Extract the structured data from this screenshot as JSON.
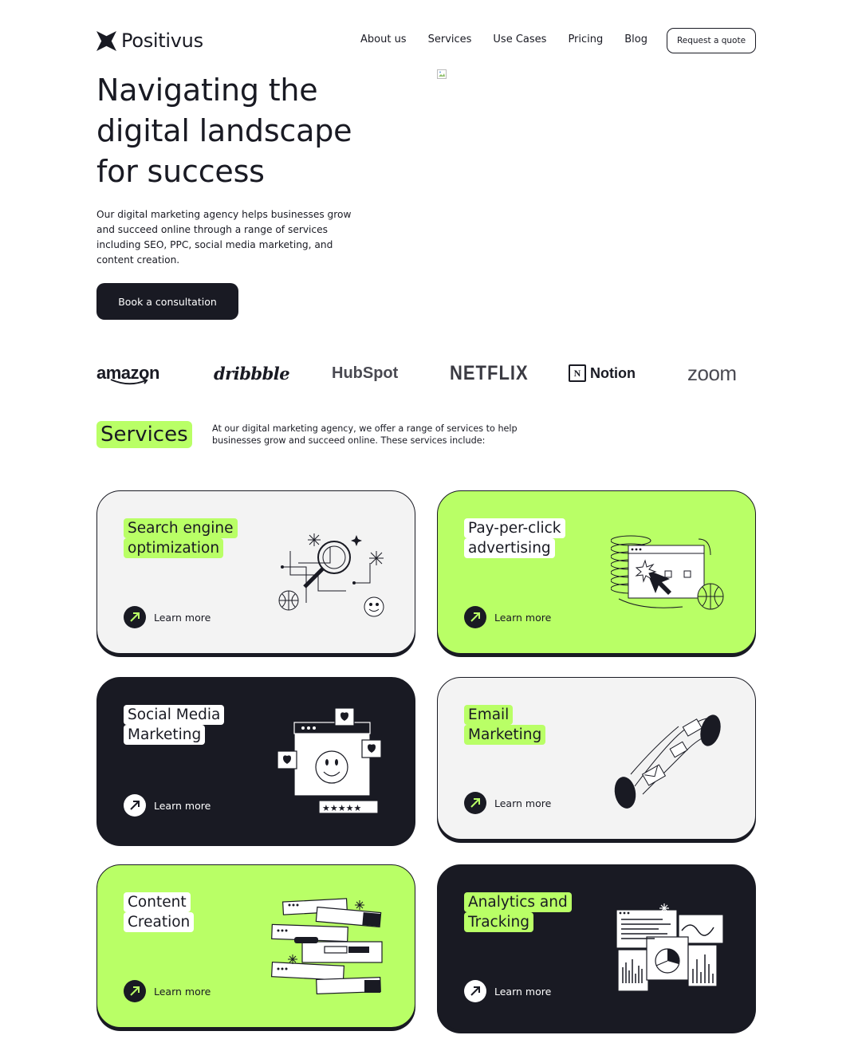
{
  "header": {
    "brand": "Positivus",
    "nav": [
      "About us",
      "Services",
      "Use Cases",
      "Pricing",
      "Blog"
    ],
    "cta": "Request a quote"
  },
  "hero": {
    "title": "Navigating the digital landscape for success",
    "description": "Our digital marketing agency helps businesses grow and succeed online through a range of services including SEO, PPC, social media marketing, and content creation.",
    "button": "Book a consultation"
  },
  "clients": {
    "amazon": "amazon",
    "dribbble": "dribbble",
    "hubspot": "HubSpot",
    "netflix": "NETFLIX",
    "notion": "Notion",
    "zoom": "zoom"
  },
  "services": {
    "title": "Services",
    "description": "At our digital marketing agency, we offer a range of services to help businesses grow and succeed online. These services include:",
    "learn_more": "Learn more",
    "cards": [
      {
        "line1": "Search engine",
        "line2": "optimization"
      },
      {
        "line1": "Pay-per-click",
        "line2": "advertising"
      },
      {
        "line1": "Social Media",
        "line2": "Marketing"
      },
      {
        "line1": "Email",
        "line2": "Marketing"
      },
      {
        "line1": "Content",
        "line2": "Creation"
      },
      {
        "line1": "Analytics and",
        "line2": "Tracking"
      }
    ]
  },
  "colors": {
    "accent": "#B9FF66",
    "dark": "#191A23",
    "grey": "#F3F3F3"
  }
}
